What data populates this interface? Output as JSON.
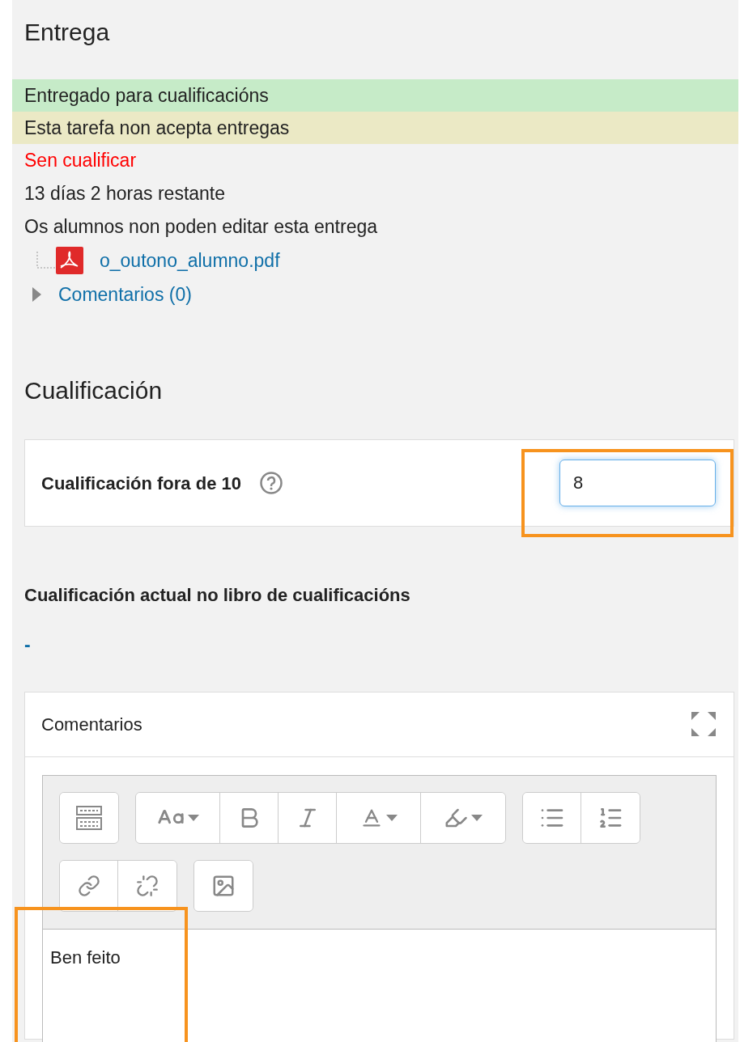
{
  "submission": {
    "heading": "Entrega",
    "statuses": [
      {
        "text": "Entregado para cualificacións",
        "color": "#c6ebc8"
      },
      {
        "text": "Esta tarefa non acepta entregas",
        "color": "#ebe9c5"
      }
    ],
    "grading_status": "Sen cualificar",
    "time_remaining": "13 días 2 horas restante",
    "editing_note": "Os alumnos non poden editar esta entrega",
    "file": {
      "name": "o_outono_alumno.pdf"
    },
    "comments_link": {
      "label": "Comentarios (0)",
      "expanded": false
    }
  },
  "grade": {
    "heading": "Cualificación",
    "label": "Cualificación fora de 10",
    "value": "8",
    "current_label": "Cualificación actual no libro de cualificacións",
    "current_value": "-"
  },
  "feedback": {
    "title": "Comentarios",
    "text": "Ben feito"
  }
}
